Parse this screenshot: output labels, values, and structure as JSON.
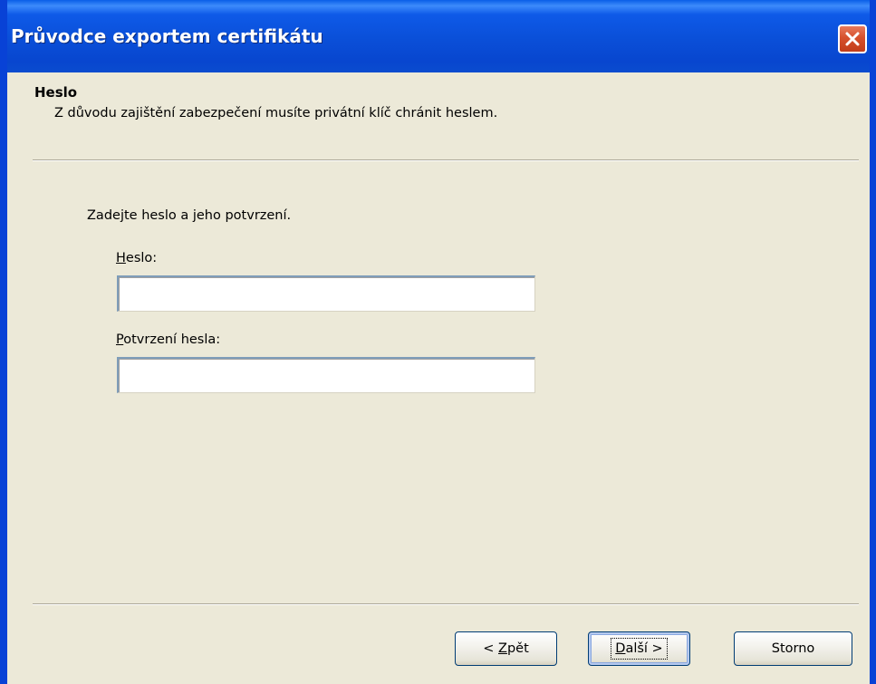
{
  "window": {
    "title": "Průvodce exportem certifikátu",
    "close_label": "×"
  },
  "header": {
    "title": "Heslo",
    "subtitle": "Z důvodu zajištění zabezpečení musíte privátní klíč chránit heslem."
  },
  "body": {
    "instruction": "Zadejte heslo a jeho potvrzení.",
    "password": {
      "label_access_key": "H",
      "label_rest": "eslo:",
      "value": "",
      "placeholder": ""
    },
    "confirm": {
      "label_access_key": "P",
      "label_rest": "otvrzení hesla:",
      "value": "",
      "placeholder": ""
    }
  },
  "buttons": {
    "back": {
      "prefix": "< ",
      "access_key": "Z",
      "rest": "pět"
    },
    "next": {
      "access_key": "D",
      "rest": "alší >"
    },
    "cancel": "Storno"
  },
  "colors": {
    "titlebar": "#0842d6",
    "dialog_bg": "#ece9d8",
    "close_button": "#d6502c"
  }
}
